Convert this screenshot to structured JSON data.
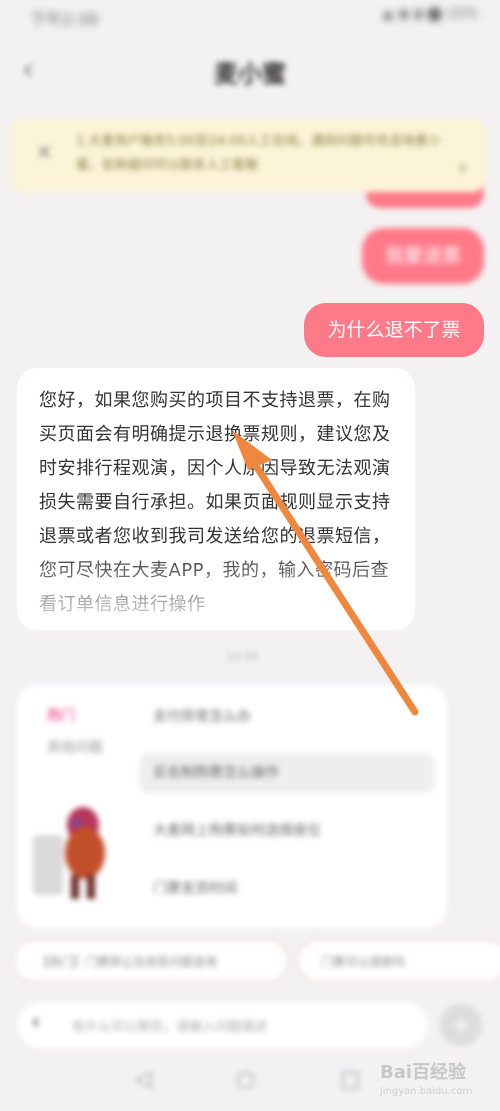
{
  "status_bar": {
    "time": "下午2:39",
    "icons": "▲ ◉ ▮ ⬤ 15%"
  },
  "header": {
    "back_icon": "‹",
    "title": "麦小蜜"
  },
  "notice": {
    "close_icon": "✕",
    "text": "1.大麦用户服务5:00至24:00人工在线，遇到问题可先咨询麦小蜜，如有疑问可以联系人工客服",
    "chevron": "∨"
  },
  "user_messages": [
    "我要退票",
    "为什么退不了票"
  ],
  "assistant_reply": {
    "text": "您好，如果您购买的项目不支持退票，在购买页面会有明确提示退换票规则，建议您及时安排行程观演，因个人原因导致无法观演损失需要自行承担。如果页面规则显示支持退票或者您收到我司发送给您的退票短信，您可尽快在大麦APP，我的，输入密码后查看订单信息进行操作"
  },
  "time_chip": "14:39",
  "faq": {
    "tab_hot": "热门",
    "tab_other": "其他问题",
    "questions": [
      "支付异常怎么办",
      "实名制购票怎么操作",
      "大麦网上购票如何选择座位",
      "门票发货时间"
    ],
    "mascot_icon": "mascot-figure"
  },
  "chips": [
    "【热门】门票转让及改签问题咨询",
    "门票可以退款吗"
  ],
  "composer": {
    "mic_icon": "◖",
    "placeholder": "有什么可以帮您，请输入问题描述",
    "plus": "+"
  },
  "navbar": {
    "back": "◁",
    "home": "○",
    "recent": "□"
  },
  "watermark": {
    "logo": "Bai百经验",
    "sub": "jingyan.baidu.com"
  },
  "colors": {
    "user_bubble": "#ff7a89",
    "arrow": "#f0873f",
    "notice_bg": "#fbf4d7"
  }
}
